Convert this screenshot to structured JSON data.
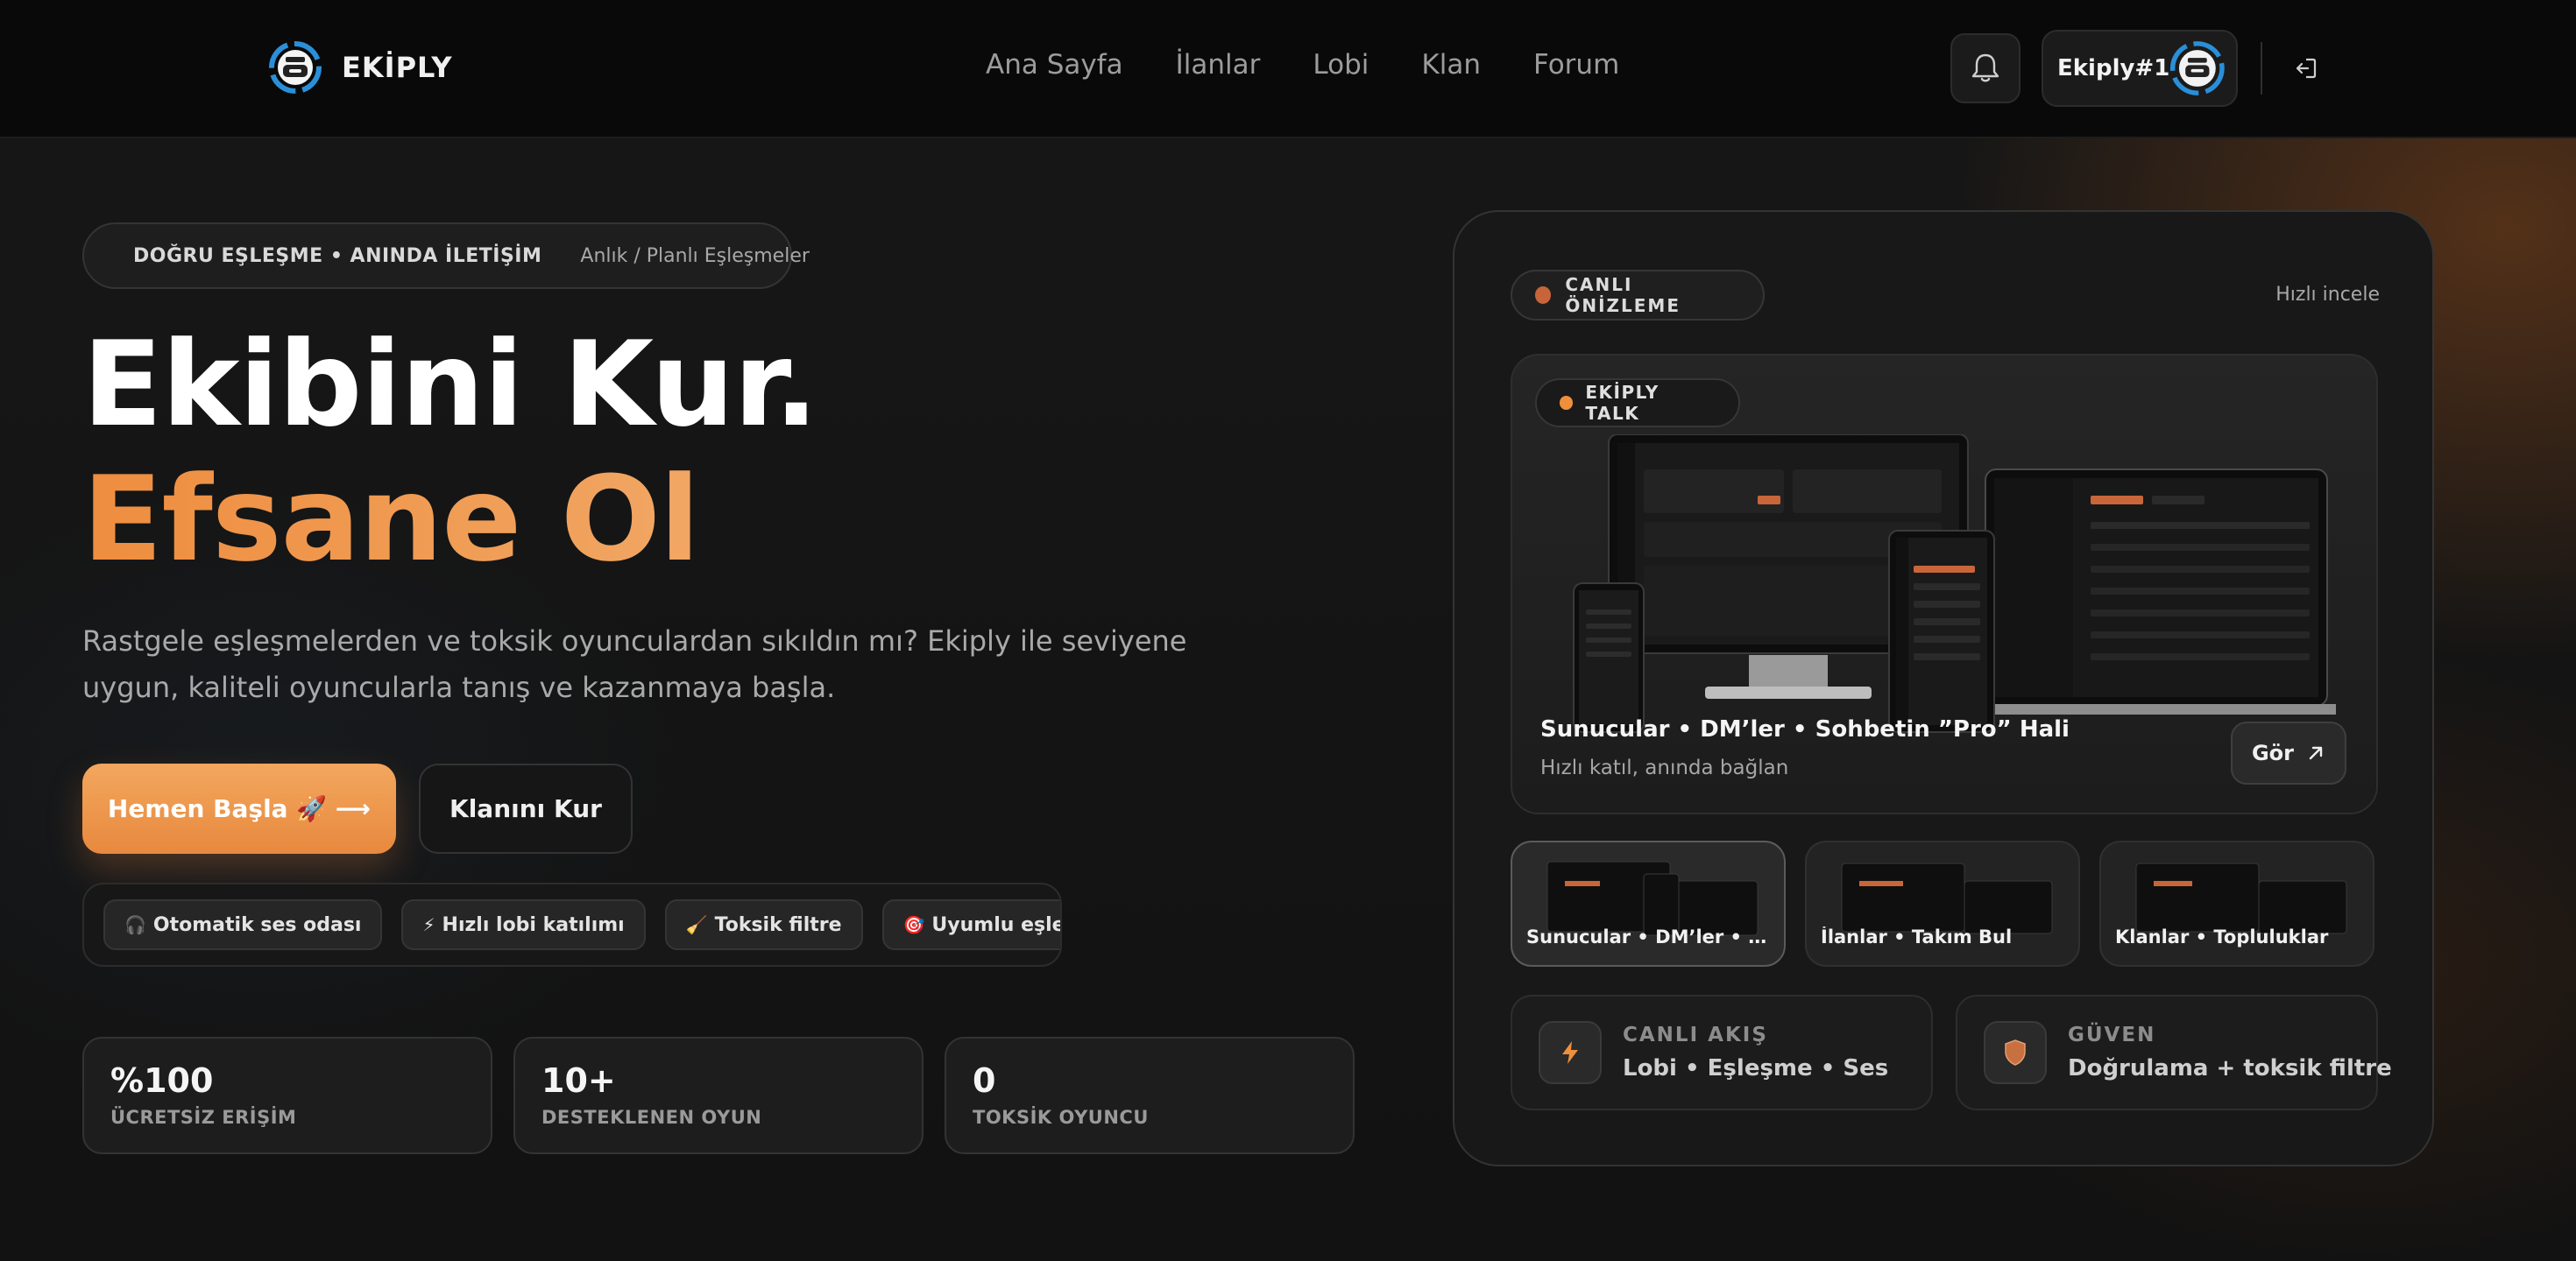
{
  "nav": {
    "brand": "EKİPLY",
    "links": [
      "Ana Sayfa",
      "İlanlar",
      "Lobi",
      "Klan",
      "Forum"
    ],
    "user": "Ekiply#1"
  },
  "hero": {
    "badge_main": "DOĞRU EŞLEŞME • ANINDA İLETİŞİM",
    "badge_sub": "Anlık / Planlı Eşleşmeler",
    "title_line1": "Ekibini Kur.",
    "title_line2": "Efsane Ol",
    "lead": "Rastgele eşleşmelerden ve toksik oyunculardan sıkıldın mı? Ekiply ile seviyene uygun, kaliteli oyuncularla tanış ve kazanmaya başla.",
    "cta_primary": "Hemen Başla 🚀 ⟶",
    "cta_secondary": "Klanını Kur",
    "chips_cut": "na",
    "chips": [
      {
        "icon": "🎧",
        "label": "Otomatik ses odası"
      },
      {
        "icon": "⚡",
        "label": "Hızlı lobi katılımı"
      },
      {
        "icon": "🧹",
        "label": "Toksik filtre"
      },
      {
        "icon": "🎯",
        "label": "Uyumlu eşleşme"
      }
    ],
    "stats": [
      {
        "value": "%100",
        "label": "ÜCRETSİZ ERİŞİM"
      },
      {
        "value": "10+",
        "label": "DESTEKLENEN OYUN"
      },
      {
        "value": "0",
        "label": "TOKSİK OYUNCU"
      }
    ]
  },
  "panel": {
    "live_label": "CANLI ÖNİZLEME",
    "quick_link": "Hızlı incele",
    "talk_label": "EKİPLY TALK",
    "preview_title": "Sunucular • DM’ler • Sohbetin ”Pro” Hali",
    "preview_sub": "Hızlı katıl, anında bağlan",
    "view_button": "Gör",
    "thumbs": [
      "Sunucular • DM’ler • Sohbetin ”Pro” Hali",
      "İlanlar • Takım Bul",
      "Klanlar • Topluluklar"
    ],
    "info": [
      {
        "title": "CANLI AKIŞ",
        "sub": "Lobi • Eşleşme • Ses"
      },
      {
        "title": "GÜVEN",
        "sub": "Doğrulama + toksik filtre"
      }
    ]
  },
  "colors": {
    "accent": "#EE9446",
    "accent_dot": "#C8643A",
    "brand_blue": "#2A8FD8",
    "background": "#141414"
  }
}
